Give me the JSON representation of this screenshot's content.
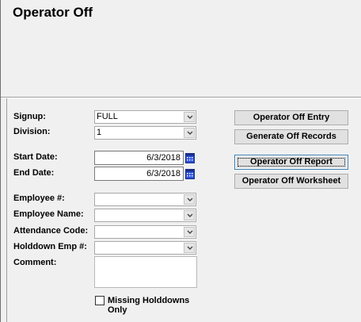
{
  "window": {
    "title": "Operator Off"
  },
  "form": {
    "signup": {
      "label": "Signup:",
      "value": "FULL"
    },
    "division": {
      "label": "Division:",
      "value": "1"
    },
    "start_date": {
      "label": "Start Date:",
      "value": "6/3/2018"
    },
    "end_date": {
      "label": "End Date:",
      "value": "6/3/2018"
    },
    "employee_num": {
      "label": "Employee #:",
      "value": ""
    },
    "employee_name": {
      "label": "Employee Name:",
      "value": ""
    },
    "attendance_code": {
      "label": "Attendance Code:",
      "value": ""
    },
    "holddown_emp": {
      "label": "Holddown Emp #:",
      "value": ""
    },
    "comment": {
      "label": "Comment:",
      "value": ""
    },
    "missing_holddowns": {
      "line1": "Missing Holddowns",
      "line2": "Only",
      "checked": false
    }
  },
  "buttons": {
    "entry": "Operator Off Entry",
    "generate": "Generate Off Records",
    "report": "Operator Off Report",
    "worksheet": "Operator Off Worksheet"
  },
  "icons": {
    "dropdown": "chevron-down-icon",
    "calendar": "calendar-icon"
  }
}
